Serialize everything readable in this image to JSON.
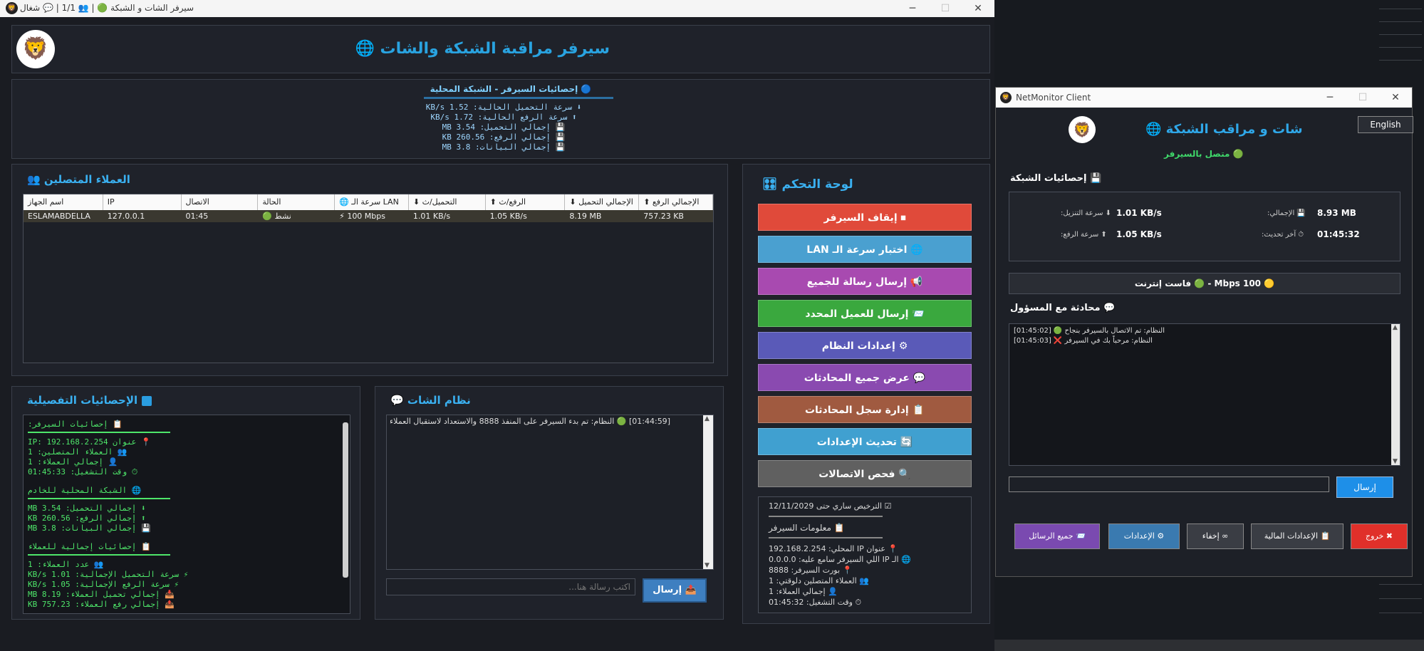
{
  "server_window": {
    "title": "سيرفر الشات و الشبكة 🟢 | 👥 1/1 | 💬 شغال",
    "header_title": "سيرفر مراقبة الشبكة والشات 🌐"
  },
  "server_stats": {
    "title": "🔵 إحصائيات السيرفر - الشبكة المحلية",
    "rows": [
      "⬇ سرعة التحميل الحالية: 1.52 KB/s",
      "⬆ سرعة الرفع الحالية: 1.72 KB/s",
      "💾 إجمالي التحميل: 3.54 MB",
      "💾 إجمالي الرفع: 260.56 KB",
      "💾 إجمالي البيانات: 3.8 MB"
    ]
  },
  "clients": {
    "title": "العملاء المتصلين 👥",
    "headers": [
      "اسم الجهاز",
      "IP",
      "الاتصال",
      "الحالة",
      "🌐 سرعة الـ LAN",
      "⬇ التحميل/ث",
      "⬆ الرفع/ث",
      "⬇ الإجمالي التحميل",
      "⬆ الإجمالي الرفع"
    ],
    "rows": [
      [
        "ESLAMABDELLA",
        "127.0.0.1",
        "01:45",
        "🟢 نشط",
        "⚡ 100 Mbps",
        "1.01 KB/s",
        "1.05 KB/s",
        "8.19 MB",
        "757.23 KB"
      ]
    ]
  },
  "detail_stats": {
    "title": "الإحصائيات التفصيلية",
    "sections": [
      {
        "head": "📋 إحصائيات السيرفر:",
        "lines": [
          "📍 عنوان IP: 192.168.2.254",
          "👥 العملاء المتصلين: 1",
          "👤 إجمالي العملاء: 1",
          "⏱ وقت التشغيل: 01:45:33"
        ]
      },
      {
        "head": "🌐 الشبكة المحلية للخادم",
        "lines": [
          "⬇ إجمالي التحميل: 3.54 MB",
          "⬆ إجمالي الرفع: 260.56 KB",
          "💾 إجمالي البيانات: 3.8 MB"
        ]
      },
      {
        "head": "📋 إحصائيات إجمالية للعملاء",
        "lines": [
          "👥 عدد العملاء: 1",
          "⚡ سرعة التحميل الإجمالية: 1.01 KB/s",
          "⚡ سرعة الرفع الإجمالية: 1.05 KB/s",
          "📥 إجمالي تحميل العملاء: 8.19 MB",
          "📤 إجمالي رفع العملاء: 757.23 KB"
        ]
      }
    ]
  },
  "chat_system": {
    "title": "نظام الشات 💬",
    "messages": [
      "[01:44:59] 🟢 النظام: تم بدء السيرفر على المنفذ 8888 والاستعداد لاستقبال العملاء"
    ],
    "placeholder": "اكتب رسالة هنا...",
    "send_label": "📤 إرسال"
  },
  "control_panel": {
    "title": "لوحة التحكم 🎛",
    "buttons": [
      {
        "label": "⏹ إيقاف السيرفر",
        "color": "#e04a3a"
      },
      {
        "label": "🌐 اختبار سرعة الـ LAN",
        "color": "#4aa0d0"
      },
      {
        "label": "📢 إرسال رسالة للجميع",
        "color": "#a84ab0"
      },
      {
        "label": "📨 إرسال للعميل المحدد",
        "color": "#3aa83e"
      },
      {
        "label": "⚙ إعدادات النظام",
        "color": "#5a5ab8"
      },
      {
        "label": "💬 عرض جميع المحادثات",
        "color": "#8a4ab0"
      },
      {
        "label": "📋 إدارة سجل المحادثات",
        "color": "#a05a40"
      },
      {
        "label": "🔄 تحديث الإعدادات",
        "color": "#40a0d0"
      },
      {
        "label": "🔍 فحص الاتصالات",
        "color": "#606060"
      }
    ],
    "license": "☑ الترخيص ساري حتى 12/11/2029",
    "server_info_title": "📋 معلومات السيرفر",
    "server_info": [
      "📍 عنوان IP المحلي: 192.168.2.254",
      "🌐 الـ IP اللي السيرفر سامع عليه: 0.0.0.0",
      "📍 بورت السيرفر: 8888",
      "👥 العملاء المتصلين دلوقتي: 1",
      "👤 إجمالي العملاء: 1",
      "⏱ وقت التشغيل: 01:45:32"
    ]
  },
  "client_window": {
    "title": "NetMonitor Client",
    "header_title": "شات و مراقب الشبكة 🌐",
    "english_label": "English",
    "status": "🟢 متصل بالسيرفر",
    "net_stats_title": "💾 إحصائيات الشبكة",
    "download_speed_label": "⬇ سرعة التنزيل:",
    "download_speed_value": "1.01 KB/s",
    "upload_speed_label": "⬆ سرعة الرفع:",
    "upload_speed_value": "1.05 KB/s",
    "total_label": "💾 الإجمالي:",
    "total_value": "8.93 MB",
    "last_update_label": "⏱ آخر تحديث:",
    "last_update_value": "01:45:32",
    "speed_banner": "🟡 100 Mbps - 🟢 فاست إنترنت",
    "chat_title": "💬 محادثة مع المسؤول",
    "messages": [
      "[01:45:02] 🟢 النظام: تم الاتصال بالسيرفر بنجاح",
      "[01:45:03] ❌ النظام: مرحباً بك في السيرفر"
    ],
    "send_label": "إرسال",
    "buttons": [
      {
        "label": "✖ خروج",
        "color": "#e0302a"
      },
      {
        "label": "📋 الإعدادات المالية",
        "color": "#3a3d44"
      },
      {
        "label": "∞ إخفاء",
        "color": "#3a3d44"
      },
      {
        "label": "⚙ الإعدادات",
        "color": "#3a7ab0"
      },
      {
        "label": "📨 جميع الرسائل",
        "color": "#7a4ab0"
      }
    ]
  }
}
